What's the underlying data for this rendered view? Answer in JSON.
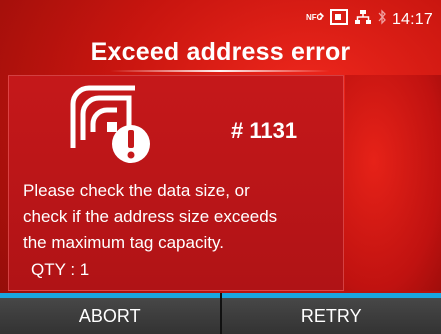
{
  "status": {
    "icons": [
      "nfc-icon",
      "rfid-tag-icon",
      "network-icon",
      "bluetooth-icon"
    ],
    "time": "14:17"
  },
  "title": "Exceed address error",
  "error": {
    "icon": "rfid-tag-error-icon",
    "code": "# 1131",
    "message_lines": [
      "Please check the data size, or",
      "check if the address size exceeds",
      "the maximum tag capacity."
    ],
    "qty": "QTY : 1"
  },
  "buttons": {
    "abort": "ABORT",
    "retry": "RETRY"
  },
  "colors": {
    "background": "#d61b14",
    "accent": "#19a6df",
    "button": "#3c3c3c"
  }
}
